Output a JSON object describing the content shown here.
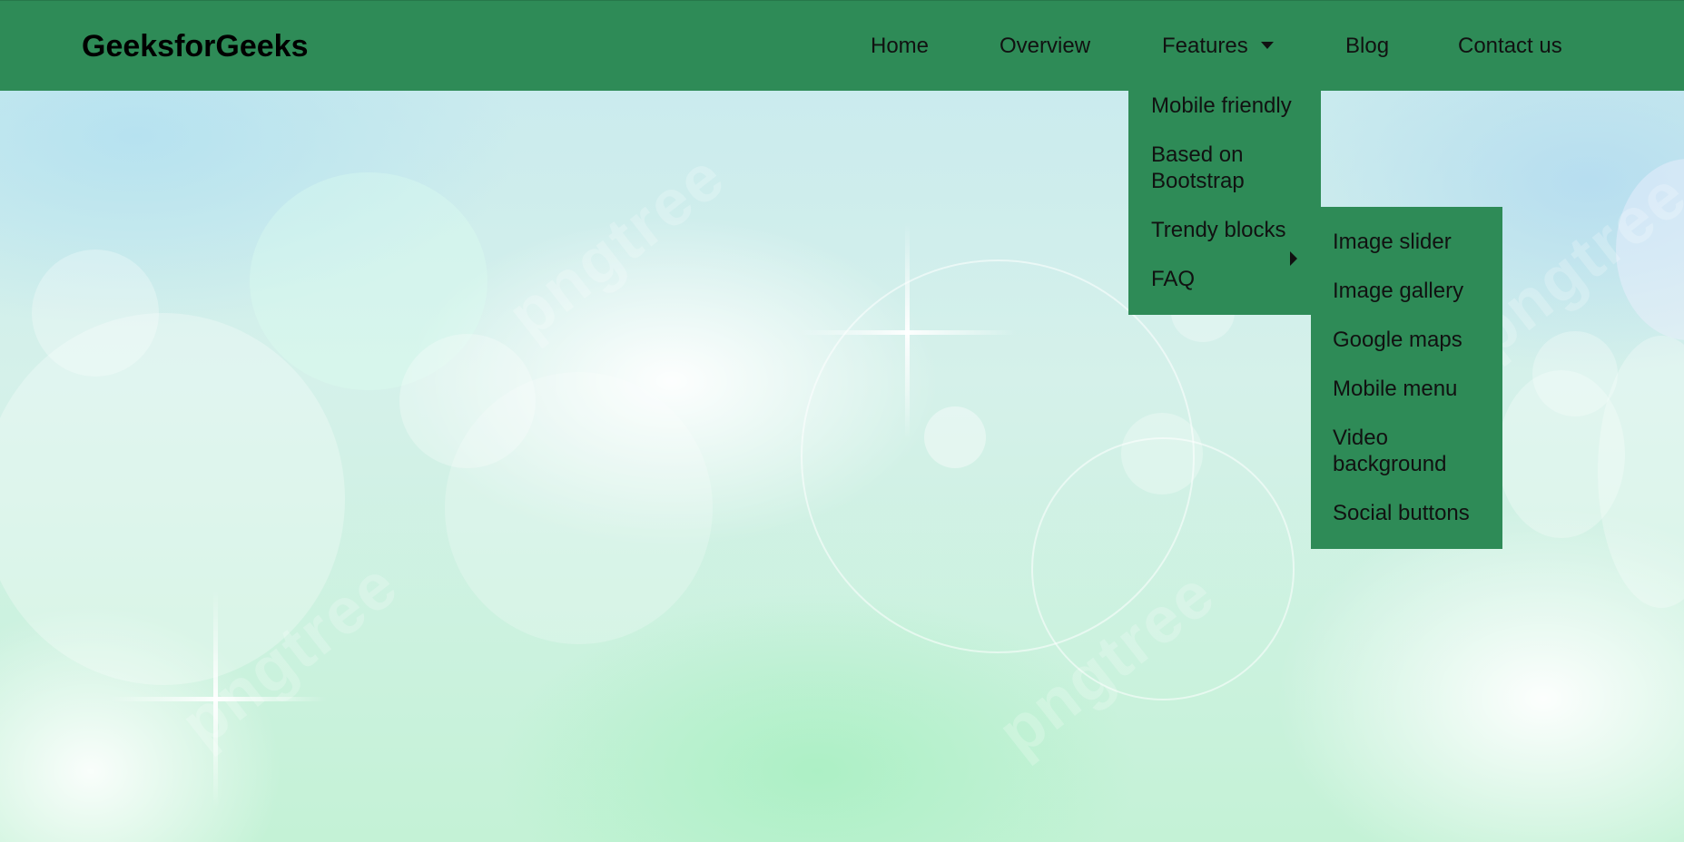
{
  "header": {
    "brand": "GeeksforGeeks"
  },
  "nav": {
    "home": "Home",
    "overview": "Overview",
    "features": "Features",
    "blog": "Blog",
    "contact": "Contact us"
  },
  "features_menu": {
    "items": [
      "Mobile friendly",
      "Based on Bootstrap",
      "Trendy blocks",
      "FAQ"
    ]
  },
  "trendy_submenu": {
    "items": [
      "Image slider",
      "Image gallery",
      "Google maps",
      "Mobile menu",
      "Video background",
      "Social buttons"
    ]
  },
  "background": {
    "watermark_text": "pngtree"
  },
  "colors": {
    "navbar": "#2e8b57",
    "text": "#111111"
  },
  "icons": {
    "features_caret": "chevron-down-icon",
    "submenu_caret": "chevron-right-icon"
  }
}
